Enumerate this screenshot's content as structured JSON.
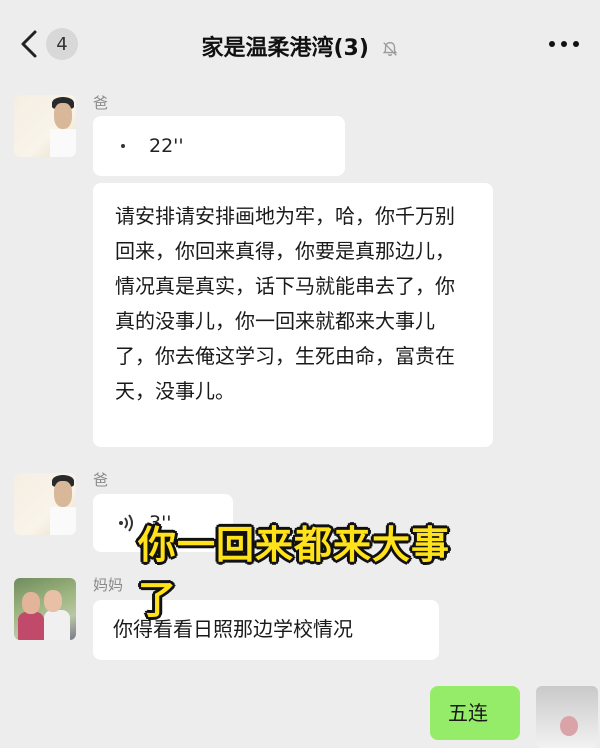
{
  "header": {
    "back_icon": "chevron-left-icon",
    "unread_count": "4",
    "title": "家是温柔港湾(3)",
    "mute_icon": "bell-muted-icon",
    "more_icon": "more-dots-icon"
  },
  "messages": [
    {
      "sender": "爸",
      "type": "voice",
      "duration": "22''"
    },
    {
      "sender": "",
      "type": "text",
      "text": "请安排请安排画地为牢，哈，你千万别回来，你回来真得，你要是真那边儿，情况真是真实，话下马就能串去了，你真的没事儿，你一回来就都来大事儿了，你去俺这学习，生死由命，富贵在天，没事儿。"
    },
    {
      "sender": "爸",
      "type": "voice",
      "duration": "3''"
    },
    {
      "sender": "妈妈",
      "type": "text",
      "text": "你得看看日照那边学校情况"
    },
    {
      "sender": "",
      "type": "text",
      "text": "五连",
      "outgoing": true
    }
  ],
  "caption": "你一回来都来大事了",
  "colors": {
    "background": "#ededed",
    "bubble_in": "#ffffff",
    "bubble_out": "#95ec69",
    "caption_text": "#ffe21a"
  }
}
